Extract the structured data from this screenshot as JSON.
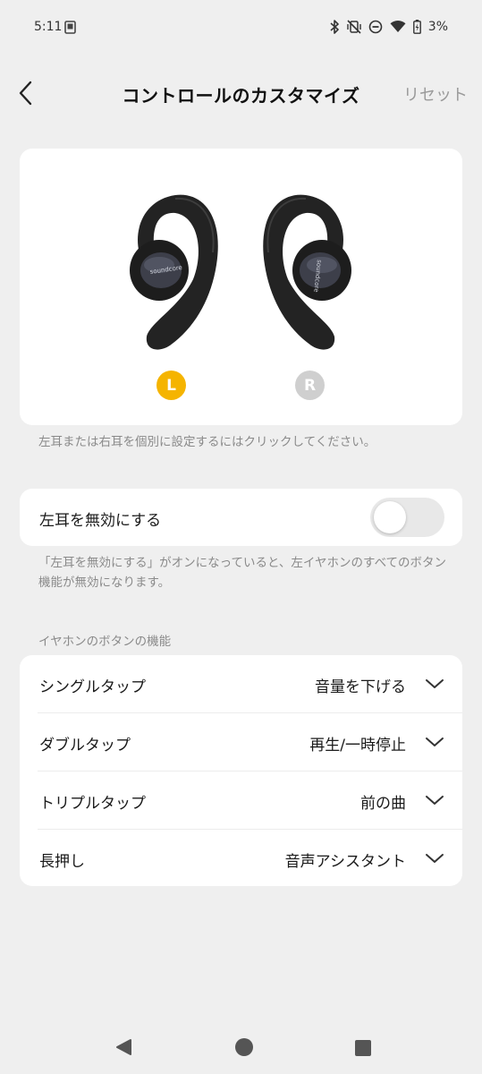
{
  "status_bar": {
    "time": "5:11",
    "battery_percent": "3%",
    "icons": [
      "screenshot-icon",
      "bluetooth-icon",
      "vibrate-off-icon",
      "do-not-disturb-icon",
      "wifi-icon",
      "battery-charging-icon"
    ]
  },
  "header": {
    "title": "コントロールのカスタマイズ",
    "reset_label": "リセット",
    "back_icon": "chevron-left-icon"
  },
  "earbuds": {
    "left_badge": "L",
    "right_badge": "R",
    "left_selected": true,
    "active_color": "#f5b400",
    "inactive_color": "#cfcfcf"
  },
  "hint_select": "左耳または右耳を個別に設定するにはクリックしてください。",
  "disable_setting": {
    "label": "左耳を無効にする",
    "enabled": false
  },
  "hint_disable": "「左耳を無効にする」がオンになっていると、左イヤホンのすべてのボタン機能が無効になります。",
  "functions": {
    "section_title": "イヤホンのボタンの機能",
    "rows": [
      {
        "label": "シングルタップ",
        "value": "音量を下げる"
      },
      {
        "label": "ダブルタップ",
        "value": "再生/一時停止"
      },
      {
        "label": "トリプルタップ",
        "value": "前の曲"
      },
      {
        "label": "長押し",
        "value": "音声アシスタント"
      }
    ]
  },
  "nav_bar": {
    "icons": [
      "nav-back-icon",
      "nav-home-icon",
      "nav-recents-icon"
    ]
  }
}
